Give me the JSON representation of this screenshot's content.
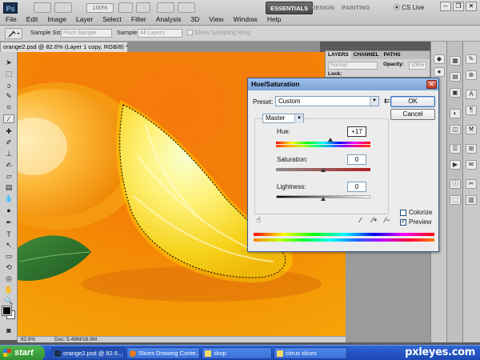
{
  "app": {
    "logo": "Ps"
  },
  "menu": [
    "File",
    "Edit",
    "Image",
    "Layer",
    "Select",
    "Filter",
    "Analysis",
    "3D",
    "View",
    "Window",
    "Help"
  ],
  "topbar": {
    "zoom": "100%",
    "workspaces": {
      "essentials": "ESSENTIALS",
      "design": "DESIGN",
      "painting": "PAINTING"
    },
    "cslive": "CS Live"
  },
  "options": {
    "sample_size_label": "Sample Size:",
    "sample_size_value": "Point Sample",
    "sample_label": "Sample:",
    "sample_value": "All Layers",
    "sampling_ring": "Show Sampling Ring"
  },
  "document": {
    "tab_title": "orange2.psd @ 82.6% (Layer 1 copy, RGB/8) *",
    "status_zoom": "82.6%",
    "status_doc": "Doc: 5.49M/16.9M"
  },
  "layers_panel": {
    "tabs": [
      "LAYERS",
      "CHANNEL",
      "PATHS"
    ],
    "blend_mode": "Normal",
    "opacity_label": "Opacity:",
    "opacity_value": "100%",
    "lock_label": "Lock:"
  },
  "dialog": {
    "title": "Hue/Saturation",
    "preset_label": "Preset:",
    "preset_value": "Custom",
    "ok": "OK",
    "cancel": "Cancel",
    "channel": "Master",
    "hue_label": "Hue:",
    "hue_value": "+17",
    "saturation_label": "Saturation:",
    "saturation_value": "0",
    "lightness_label": "Lightness:",
    "lightness_value": "0",
    "colorize_label": "Colorize",
    "colorize_checked": false,
    "preview_label": "Preview",
    "preview_checked": true
  },
  "taskbar": {
    "start": "start",
    "items": [
      {
        "label": "orange2.psd @ 82.6...",
        "active": true
      },
      {
        "label": "Slices Drawing Conte...",
        "active": false
      },
      {
        "label": "skop",
        "active": false
      },
      {
        "label": "citrus slices",
        "active": false
      }
    ],
    "watermark": "pxleyes.com"
  },
  "colors": {
    "foreground": "#000000",
    "background": "#ffffff",
    "canvas_orange": "#f47e07",
    "taskbar_blue": "#2457c8"
  }
}
